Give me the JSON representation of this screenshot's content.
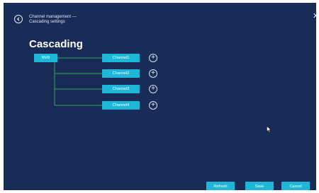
{
  "breadcrumb": [
    "Channel management —",
    "Cascading settings"
  ],
  "heading": "Cascading",
  "icons": {
    "back": "back-arrow-icon",
    "close": "close-icon",
    "add": "plus-circle-icon",
    "cursor": "mouse-cursor-icon"
  },
  "tree": {
    "root": "NVR",
    "channels": [
      "Channel1",
      "Channel2",
      "Channel3",
      "Channel4"
    ]
  },
  "footer": {
    "refresh": "Refresh",
    "save": "Save",
    "cancel": "Cancel"
  },
  "colors": {
    "background": "#182c57",
    "accent": "#1fb7d8",
    "connector": "#32a858"
  }
}
